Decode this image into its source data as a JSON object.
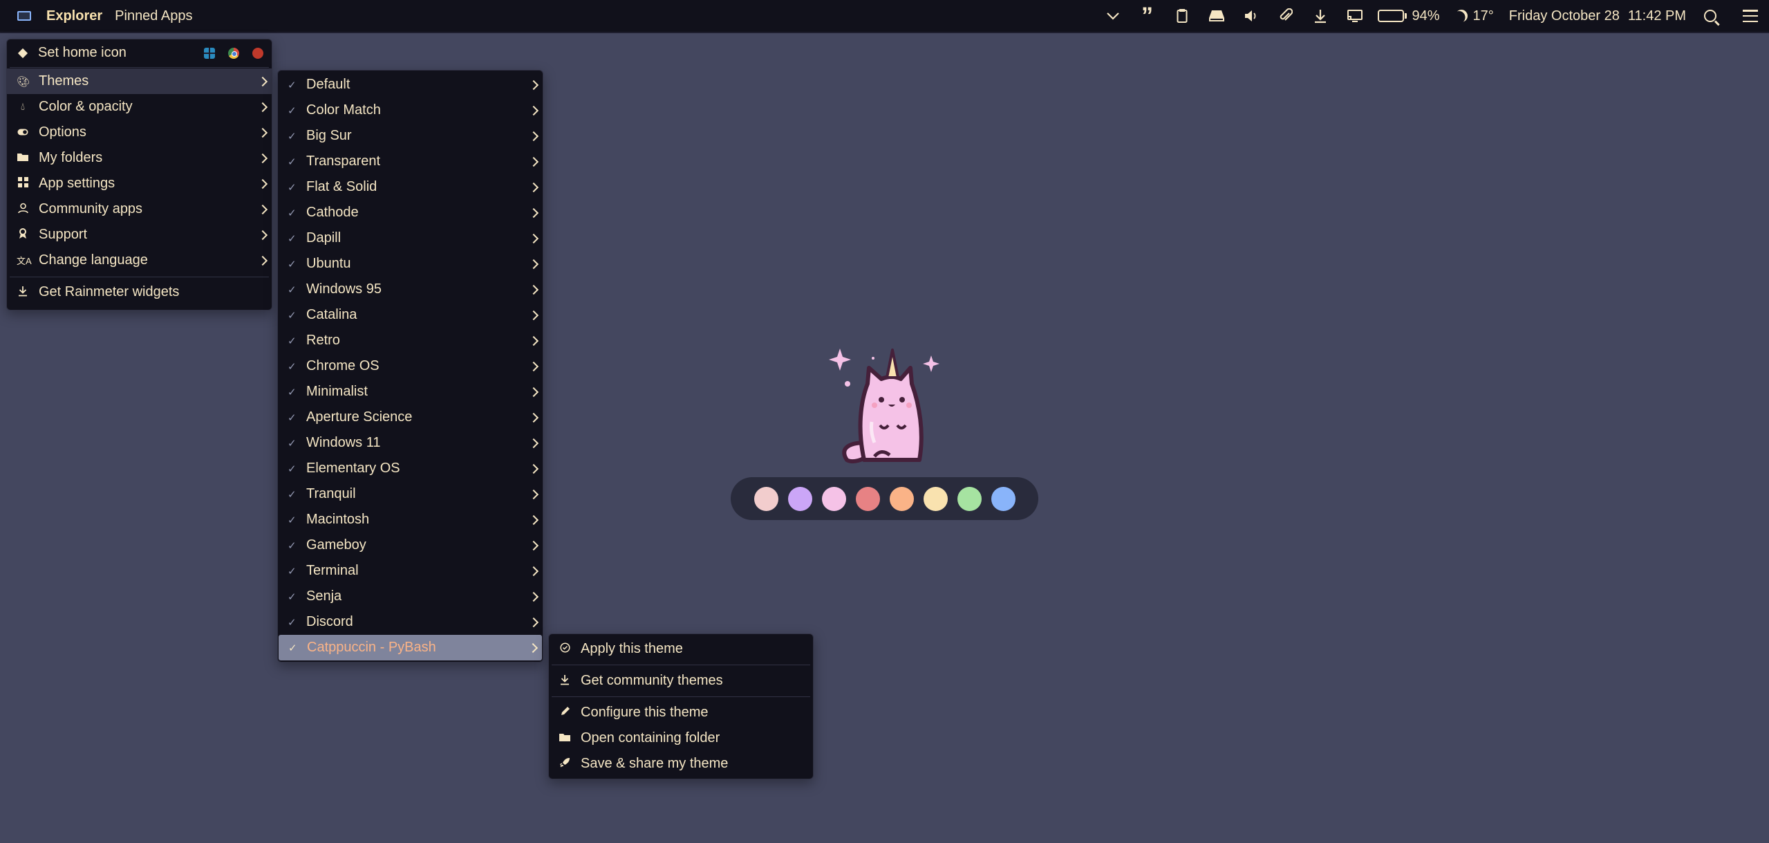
{
  "topbar": {
    "app_name": "Explorer",
    "pinned_label": "Pinned Apps",
    "tray_icons": [
      "chevron-down-icon",
      "quote-icon",
      "clipboard-icon",
      "drive-icon",
      "volume-icon",
      "paperclip-icon",
      "download-icon",
      "display-icon"
    ],
    "battery_percent": "94%",
    "battery_level": 0.94,
    "temperature": "17°",
    "date": "Friday October 28",
    "time": "11:42 PM"
  },
  "main_menu": {
    "home_label": "Set home icon",
    "items": [
      {
        "label": "Themes",
        "icon": "paint-icon",
        "submenu": true
      },
      {
        "label": "Color & opacity",
        "icon": "drop-icon",
        "submenu": true
      },
      {
        "label": "Options",
        "icon": "toggle-icon",
        "submenu": true
      },
      {
        "label": "My folders",
        "icon": "folder-icon",
        "submenu": true
      },
      {
        "label": "App settings",
        "icon": "apps-icon",
        "submenu": true
      },
      {
        "label": "Community apps",
        "icon": "person-icon",
        "submenu": true
      },
      {
        "label": "Support",
        "icon": "ribbon-icon",
        "submenu": true
      },
      {
        "label": "Change language",
        "icon": "translate-icon",
        "submenu": true
      }
    ],
    "footer_label": "Get Rainmeter widgets"
  },
  "themes_menu": {
    "items": [
      "Default",
      "Color Match",
      "Big Sur",
      "Transparent",
      "Flat & Solid",
      "Cathode",
      "Dapill",
      "Ubuntu",
      "Windows 95",
      "Catalina",
      "Retro",
      "Chrome OS",
      "Minimalist",
      "Aperture Science",
      "Windows 11",
      "Elementary OS",
      "Tranquil",
      "Macintosh",
      "Gameboy",
      "Terminal",
      "Senja",
      "Discord",
      "Catppuccin - PyBash"
    ],
    "selected": "Catppuccin - PyBash"
  },
  "theme_submenu": {
    "apply": "Apply this theme",
    "community": "Get community themes",
    "configure": "Configure this theme",
    "open_folder": "Open containing folder",
    "save_share": "Save & share my theme"
  },
  "palette": {
    "colors": [
      "#f2cdcd",
      "#cba6f7",
      "#f5c2e7",
      "#e78284",
      "#fab387",
      "#f9e2af",
      "#a6e3a1",
      "#89b4fa"
    ]
  },
  "colors": {
    "desktop": "#44475f",
    "menu_bg": "#11111b",
    "text": "#f5e6c4",
    "selected_bg": "#7f849c",
    "selected_text": "#fab387"
  }
}
